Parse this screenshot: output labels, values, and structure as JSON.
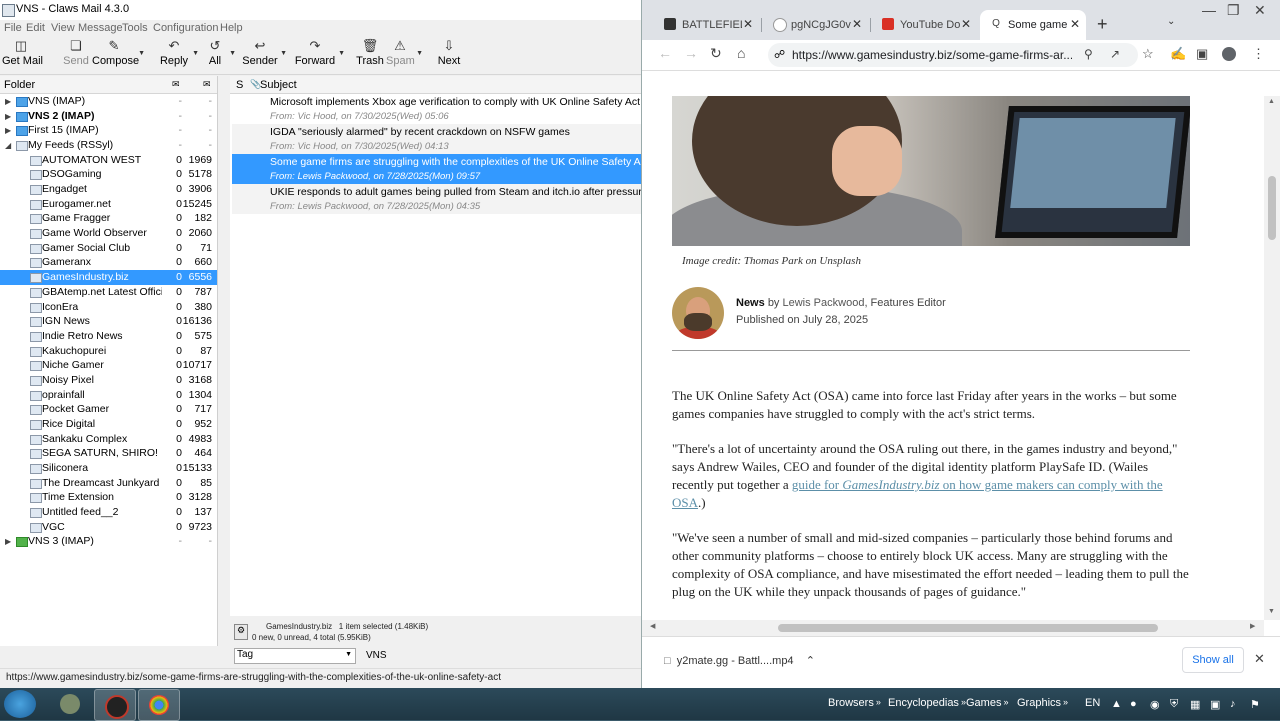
{
  "mail": {
    "title": "VNS - Claws Mail 4.3.0",
    "menu": [
      "File",
      "Edit",
      "View",
      "Message",
      "Tools",
      "Configuration",
      "Help"
    ],
    "toolbar": [
      {
        "label": "Get Mail",
        "icon": "get-mail-icon",
        "enabled": true
      },
      {
        "label": "Send",
        "icon": "send-icon",
        "enabled": false
      },
      {
        "label": "Compose",
        "icon": "compose-icon",
        "enabled": true
      },
      {
        "label": "Reply",
        "icon": "reply-icon",
        "enabled": true
      },
      {
        "label": "All",
        "icon": "reply-all-icon",
        "enabled": true
      },
      {
        "label": "Sender",
        "icon": "reply-sender-icon",
        "enabled": true
      },
      {
        "label": "Forward",
        "icon": "forward-icon",
        "enabled": true
      },
      {
        "label": "Trash",
        "icon": "trash-icon",
        "enabled": true
      },
      {
        "label": "Spam",
        "icon": "spam-icon",
        "enabled": false
      },
      {
        "label": "Next",
        "icon": "next-icon",
        "enabled": true
      }
    ],
    "folder_header": "Folder",
    "folders": [
      {
        "name": "VNS (IMAP)",
        "level": 0,
        "expand": "collapsed",
        "type": "imap",
        "new": "-",
        "total": "-",
        "bold": false
      },
      {
        "name": "VNS 2 (IMAP)",
        "level": 0,
        "expand": "collapsed",
        "type": "imap",
        "new": "-",
        "total": "-",
        "bold": true
      },
      {
        "name": "First 15 (IMAP)",
        "level": 0,
        "expand": "collapsed",
        "type": "imap",
        "new": "-",
        "total": "-",
        "bold": false
      },
      {
        "name": "My Feeds (RSSyl)",
        "level": 0,
        "expand": "expanded",
        "type": "rss",
        "new": "-",
        "total": "-",
        "bold": false
      },
      {
        "name": "AUTOMATON WEST",
        "level": 1,
        "type": "feed",
        "new": "0",
        "total": "1969"
      },
      {
        "name": "DSOGaming",
        "level": 1,
        "type": "feed",
        "new": "0",
        "total": "5178"
      },
      {
        "name": "Engadget",
        "level": 1,
        "type": "feed",
        "new": "0",
        "total": "3906"
      },
      {
        "name": "Eurogamer.net",
        "level": 1,
        "type": "feed",
        "new": "0",
        "total": "15245"
      },
      {
        "name": "Game Fragger",
        "level": 1,
        "type": "feed",
        "new": "0",
        "total": "182"
      },
      {
        "name": "Game World Observer",
        "level": 1,
        "type": "feed",
        "new": "0",
        "total": "2060"
      },
      {
        "name": "Gamer Social Club",
        "level": 1,
        "type": "feed",
        "new": "0",
        "total": "71"
      },
      {
        "name": "Gameranx",
        "level": 1,
        "type": "feed",
        "new": "0",
        "total": "660"
      },
      {
        "name": "GamesIndustry.biz",
        "level": 1,
        "type": "feed",
        "new": "0",
        "total": "6556",
        "selected": true
      },
      {
        "name": "GBAtemp.net Latest Offici",
        "level": 1,
        "type": "feed",
        "new": "0",
        "total": "787"
      },
      {
        "name": "IconEra",
        "level": 1,
        "type": "feed",
        "new": "0",
        "total": "380"
      },
      {
        "name": "IGN News",
        "level": 1,
        "type": "feed",
        "new": "0",
        "total": "16136"
      },
      {
        "name": "Indie Retro News",
        "level": 1,
        "type": "feed",
        "new": "0",
        "total": "575"
      },
      {
        "name": "Kakuchopurei",
        "level": 1,
        "type": "feed",
        "new": "0",
        "total": "87"
      },
      {
        "name": "Niche Gamer",
        "level": 1,
        "type": "feed",
        "new": "0",
        "total": "10717"
      },
      {
        "name": "Noisy Pixel",
        "level": 1,
        "type": "feed",
        "new": "0",
        "total": "3168"
      },
      {
        "name": "oprainfall",
        "level": 1,
        "type": "feed",
        "new": "0",
        "total": "1304"
      },
      {
        "name": "Pocket Gamer",
        "level": 1,
        "type": "feed",
        "new": "0",
        "total": "717"
      },
      {
        "name": "Rice Digital",
        "level": 1,
        "type": "feed",
        "new": "0",
        "total": "952"
      },
      {
        "name": "Sankaku Complex",
        "level": 1,
        "type": "feed",
        "new": "0",
        "total": "4983"
      },
      {
        "name": "SEGA SATURN, SHIRO!",
        "level": 1,
        "type": "feed",
        "new": "0",
        "total": "464"
      },
      {
        "name": "Siliconera",
        "level": 1,
        "type": "feed",
        "new": "0",
        "total": "15133"
      },
      {
        "name": "The Dreamcast Junkyard",
        "level": 1,
        "type": "feed",
        "new": "0",
        "total": "85"
      },
      {
        "name": "Time Extension",
        "level": 1,
        "type": "feed",
        "new": "0",
        "total": "3128"
      },
      {
        "name": "Untitled feed__2",
        "level": 1,
        "type": "feed",
        "new": "0",
        "total": "137"
      },
      {
        "name": "VGC",
        "level": 1,
        "type": "feed",
        "new": "0",
        "total": "9723"
      },
      {
        "name": "VNS 3 (IMAP)",
        "level": 0,
        "expand": "collapsed",
        "type": "imap-green",
        "new": "-",
        "total": "-",
        "bold": false
      }
    ],
    "message_header": {
      "s": "S",
      "subject": "Subject"
    },
    "messages": [
      {
        "subject": "Microsoft implements Xbox age verification to comply with UK Online Safety Act",
        "from": "From: Vic Hood, on 7/30/2025(Wed) 05:06"
      },
      {
        "subject": "IGDA \"seriously alarmed\" by recent crackdown on NSFW games",
        "from": "From: Vic Hood, on 7/30/2025(Wed) 04:13"
      },
      {
        "subject": "Some game firms are struggling with the complexities of the UK Online Safety Act",
        "from": "From: Lewis Packwood, on 7/28/2025(Mon) 09:57",
        "selected": true
      },
      {
        "subject": "UKIE responds to adult games being pulled from Steam and itch.io after pressure fro",
        "from": "From: Lewis Packwood, on 7/28/2025(Mon) 04:35"
      }
    ],
    "status_folder": "GamesIndustry.biz",
    "status_selected": "1 item selected (1.48KiB)",
    "status_counts": "0 new, 0 unread, 4 total (5.95KiB)",
    "tag_select": "Tag",
    "account_label": "VNS",
    "status_url": "https://www.gamesindustry.biz/some-game-firms-are-struggling-with-the-complexities-of-the-uk-online-safety-act"
  },
  "chrome": {
    "tabs": [
      {
        "title": "BATTLEFIELD",
        "icon_color": "#333333",
        "active": false
      },
      {
        "title": "pgNCgJG0v",
        "icon_color": "#bbbbbb",
        "active": false
      },
      {
        "title": "YouTube Do",
        "icon_color": "#d93025",
        "active": false
      },
      {
        "title": "Some game",
        "icon_color": "#555555",
        "active": true
      }
    ],
    "url": "https://www.gamesindustry.biz/some-game-firms-ar...",
    "article": {
      "image_credit": "Image credit: Thomas Park on Unsplash",
      "category": "News",
      "by": "by",
      "author": "Lewis Packwood",
      "author_role": ", Features Editor",
      "published": "Published on July 28, 2025",
      "p1": "The UK Online Safety Act (OSA) came into force last Friday after years in the works – but some games companies have struggled to comply with the act's strict terms.",
      "p2_a": "\"There's a lot of uncertainty around the OSA ruling out there, in the games industry and beyond,\" says Andrew Wailes, CEO and founder of the digital identity platform PlaySafe ID. (Wailes recently put together a ",
      "p2_link_a": "guide for ",
      "p2_link_i": "GamesIndustry.biz",
      "p2_link_b": " on how game makers can comply with the OSA",
      "p2_b": ".)",
      "p3": "\"We've seen a number of small and mid-sized companies – particularly those behind forums and other community platforms – choose to entirely block UK access. Many are struggling with the complexity of OSA compliance, and have misestimated the effort needed – leading them to pull the plug on the UK while they unpack thousands of pages of guidance.\""
    },
    "download": {
      "name": "y2mate.gg - Battl....mp4",
      "show_all": "Show all"
    }
  },
  "taskbar": {
    "groups": [
      "Browsers",
      "Encyclopedias",
      "Games",
      "Graphics"
    ],
    "lang": "EN"
  }
}
